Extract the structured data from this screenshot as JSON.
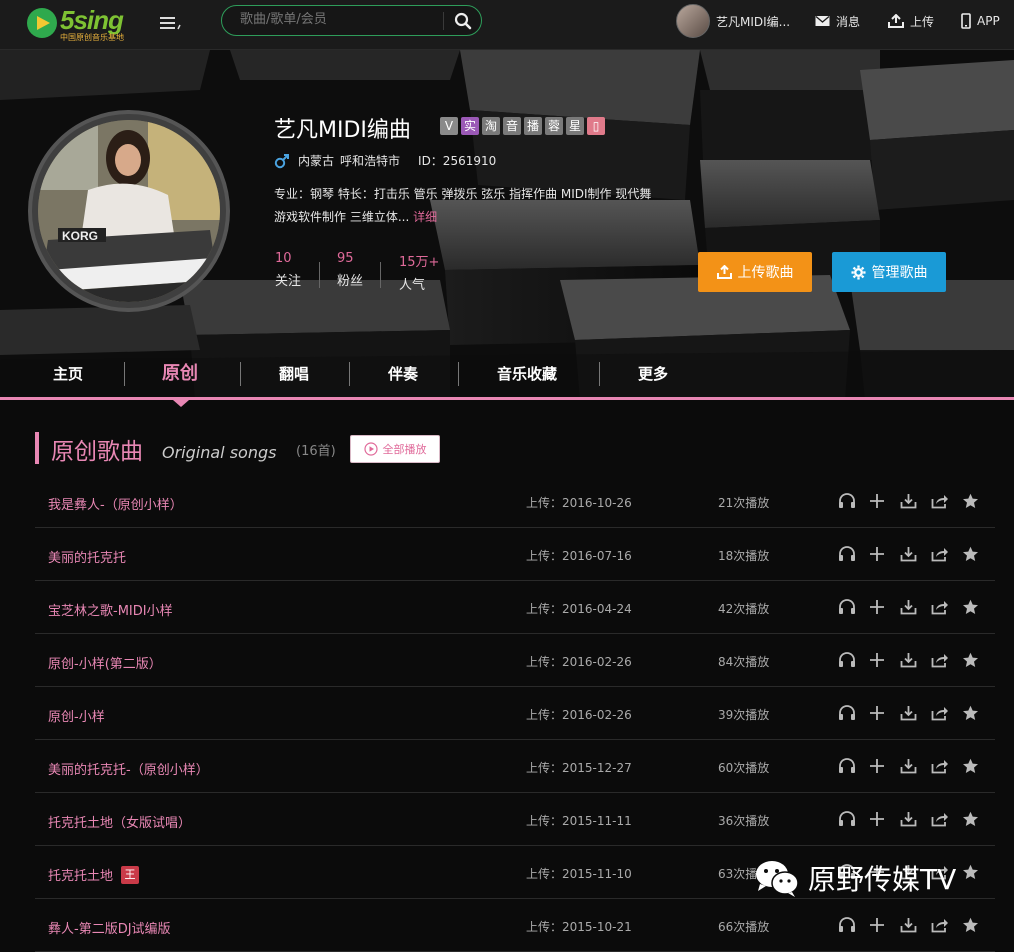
{
  "header": {
    "logo_text": "5sing",
    "logo_sub": "中国原创音乐基地",
    "search_placeholder": "歌曲/歌单/会员",
    "user_name": "艺凡MIDI编...",
    "messages": "消息",
    "upload": "上传",
    "app": "APP"
  },
  "profile": {
    "name": "艺凡MIDI编曲",
    "badges": [
      "V",
      "实",
      "淘",
      "音",
      "播",
      "蓉",
      "星",
      "▯"
    ],
    "badge_colors": [
      "#8a8a8a",
      "#9b59b6",
      "#7a7a7a",
      "#7a7a7a",
      "#7a7a7a",
      "#7a7a7a",
      "#7a7a7a",
      "#e07a8a"
    ],
    "gender_icon": "male-icon",
    "province": "内蒙古",
    "city": "呼和浩特市",
    "id_label": "ID：2561910",
    "bio": "专业：钢琴 特长：打击乐 管乐 弹拨乐 弦乐 指挥作曲 MIDI制作 现代舞 游戏软件制作 三维立体...",
    "bio_more": "详细",
    "stats": {
      "follow_value": "10",
      "follow_label": "关注",
      "fans_value": "95",
      "fans_label": "粉丝",
      "pop_value": "15万+",
      "pop_label": "人气"
    },
    "upload_button": "上传歌曲",
    "manage_button": "管理歌曲"
  },
  "tabs": {
    "home": "主页",
    "original": "原创",
    "cover": "翻唱",
    "accomp": "伴奏",
    "collection": "音乐收藏",
    "more": "更多"
  },
  "section": {
    "title": "原创歌曲",
    "subtitle": "Original songs",
    "count": "(16首)",
    "play_all": "全部播放"
  },
  "songs": [
    {
      "title": "我是彝人-（原创小样）",
      "date": "上传：2016-10-26",
      "plays": "21次播放"
    },
    {
      "title": "美丽的托克托",
      "date": "上传：2016-07-16",
      "plays": "18次播放"
    },
    {
      "title": "宝芝林之歌-MIDI小样",
      "date": "上传：2016-04-24",
      "plays": "42次播放"
    },
    {
      "title": "原创-小样(第二版）",
      "date": "上传：2016-02-26",
      "plays": "84次播放"
    },
    {
      "title": "原创-小样",
      "date": "上传：2016-02-26",
      "plays": "39次播放"
    },
    {
      "title": "美丽的托克托-（原创小样）",
      "date": "上传：2015-12-27",
      "plays": "60次播放"
    },
    {
      "title": "托克托土地（女版试唱）",
      "date": "上传：2015-11-11",
      "plays": "36次播放"
    },
    {
      "title": "托克托土地",
      "tag": "王",
      "date": "上传：2015-11-10",
      "plays": "63次播放"
    },
    {
      "title": "彝人-第二版DJ试编版",
      "date": "上传：2015-10-21",
      "plays": "66次播放"
    }
  ],
  "watermark": {
    "text": "原野传媒TV"
  }
}
